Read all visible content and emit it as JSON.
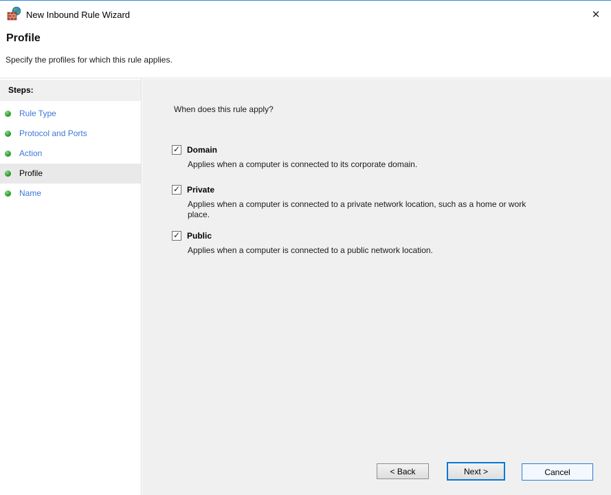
{
  "window": {
    "title": "New Inbound Rule Wizard",
    "close_glyph": "✕"
  },
  "header": {
    "title": "Profile",
    "subtitle": "Specify the profiles for which this rule applies."
  },
  "sidebar": {
    "heading": "Steps:",
    "items": [
      {
        "label": "Rule Type",
        "state": "link"
      },
      {
        "label": "Protocol and Ports",
        "state": "link"
      },
      {
        "label": "Action",
        "state": "link"
      },
      {
        "label": "Profile",
        "state": "current"
      },
      {
        "label": "Name",
        "state": "link"
      }
    ]
  },
  "content": {
    "question": "When does this rule apply?",
    "profiles": [
      {
        "label": "Domain",
        "checked": true,
        "description": "Applies when a computer is connected to its corporate domain."
      },
      {
        "label": "Private",
        "checked": true,
        "description": "Applies when a computer is connected to a private network location, such as a home or work place."
      },
      {
        "label": "Public",
        "checked": true,
        "description": "Applies when a computer is connected to a public network location."
      }
    ]
  },
  "footer": {
    "back_label": "< Back",
    "next_label": "Next >",
    "cancel_label": "Cancel"
  },
  "colors": {
    "accent_top_border": "#2B8AD9",
    "step_link_blue": "#3B77D9",
    "bullet_green": "#2FA32F",
    "current_step_bg": "#E9E9E9",
    "pane_bg": "#F0F0F0",
    "next_focus_border": "#0078D7"
  }
}
